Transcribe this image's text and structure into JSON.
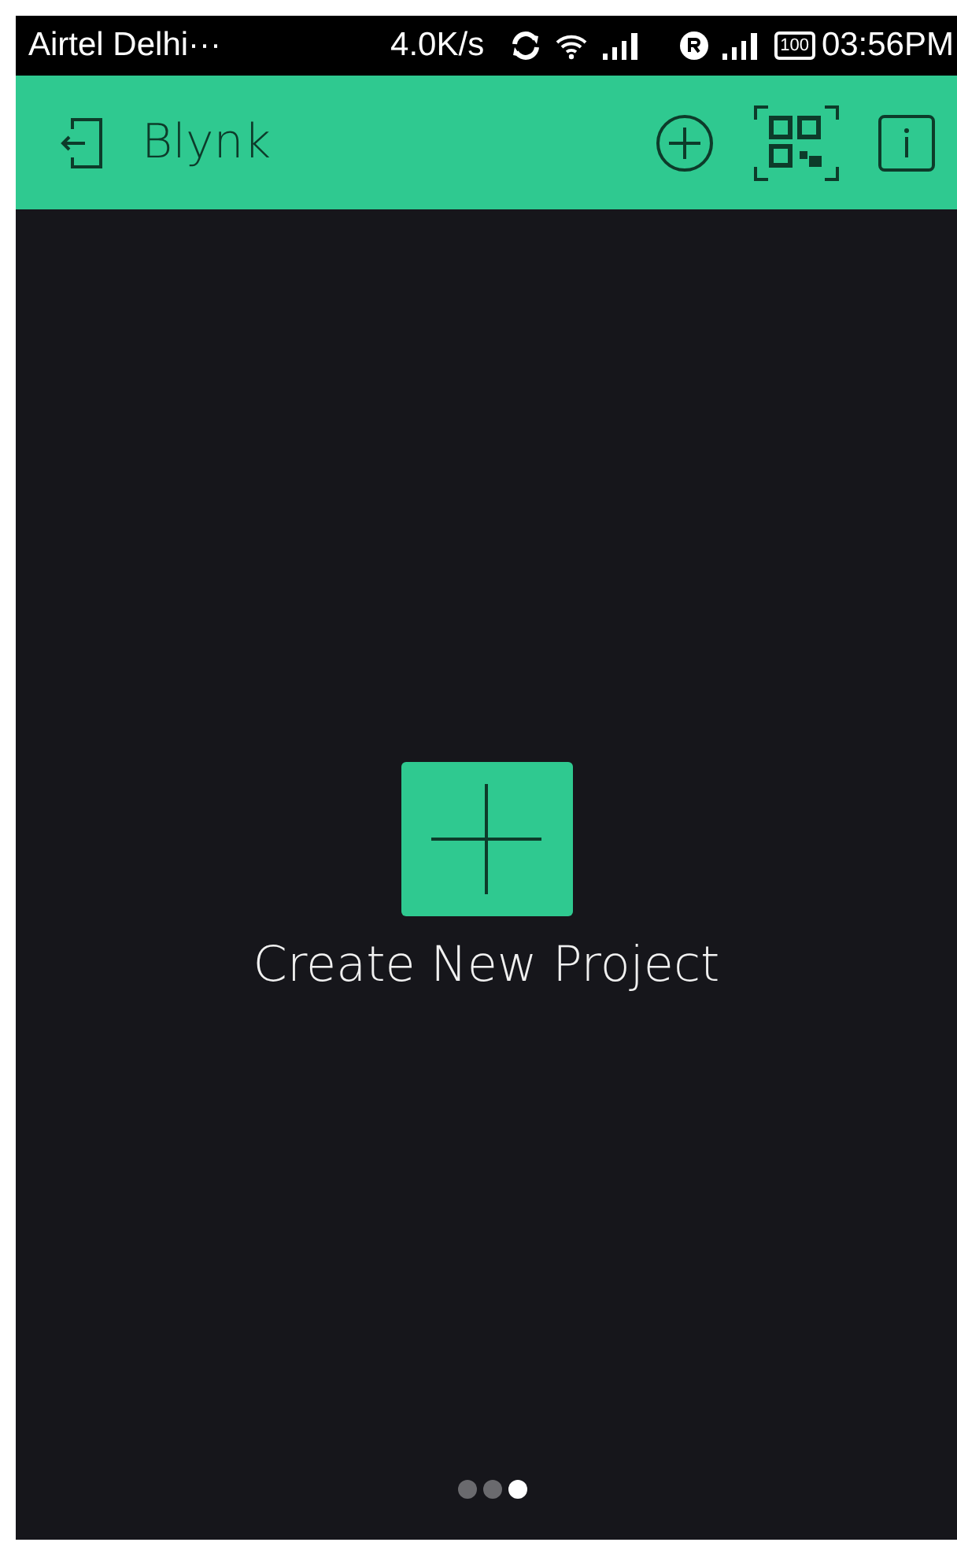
{
  "status_bar": {
    "carrier": "Airtel Delhi···",
    "speed": "4.0K/s",
    "battery": "100",
    "time": "03:56PM"
  },
  "app_bar": {
    "title": "Blynk"
  },
  "create_project": {
    "label": "Create New Project"
  },
  "page_dots": [
    {
      "selected": false
    },
    {
      "selected": false
    },
    {
      "selected": true
    }
  ]
}
